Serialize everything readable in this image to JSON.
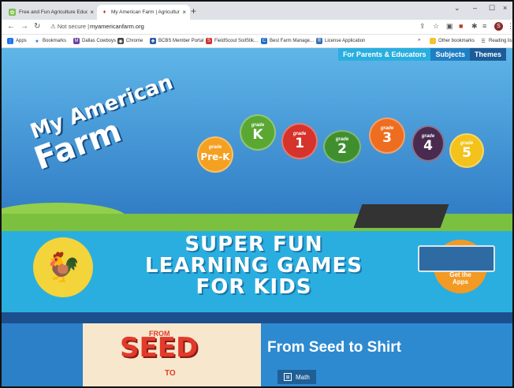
{
  "browser": {
    "tabs": [
      {
        "title": "Free and Fun Agriculture Educat",
        "close": "×",
        "favicon": "leaf-icon"
      },
      {
        "title": "My American Farm | Agricultural",
        "close": "×",
        "favicon": "farm-icon"
      }
    ],
    "new_tab": "+",
    "window": {
      "minimize": "–",
      "maximize": "☐",
      "close": "×",
      "dropdown": "⌄"
    },
    "security": "Not secure",
    "url": "myamericanfarm.org",
    "profile_initial": "S",
    "bookmarks": [
      {
        "label": "Apps",
        "icon": "apps-grid-icon",
        "color": "#1a73e8"
      },
      {
        "label": "Bookmarks",
        "icon": "star-icon",
        "color": "#1a73e8"
      },
      {
        "label": "Dallas Cowboys",
        "icon": "cowboys-icon",
        "color": "#6a3fa0"
      },
      {
        "label": "Chrome",
        "icon": "chrome-icon",
        "color": "#444444"
      },
      {
        "label": "BCBS Member Portal",
        "icon": "bcbs-icon",
        "color": "#2c5aa0"
      },
      {
        "label": "FieldScout SoilStik...",
        "icon": "fieldscout-icon",
        "color": "#d0302f"
      },
      {
        "label": "Best Farm Manage...",
        "icon": "bfm-icon",
        "color": "#1f6fc2"
      },
      {
        "label": "License Application",
        "icon": "license-icon",
        "color": "#3b6fb5"
      }
    ],
    "bookmarks_overflow": "»",
    "other_bookmarks": "Other bookmarks",
    "reading_list": "Reading list"
  },
  "site": {
    "nav": [
      "For Parents & Educators",
      "Subjects",
      "Themes"
    ],
    "logo": {
      "line1": "My",
      "line1b": "American",
      "line2": "Farm"
    },
    "grades": [
      {
        "grade": "grade",
        "label": "Pre-K",
        "color": "#f4a021"
      },
      {
        "grade": "grade",
        "label": "K",
        "color": "#5aa832"
      },
      {
        "grade": "grade",
        "label": "1",
        "color": "#d6332a"
      },
      {
        "grade": "grade",
        "label": "2",
        "color": "#3f8f2e"
      },
      {
        "grade": "grade",
        "label": "3",
        "color": "#ee6d1f"
      },
      {
        "grade": "grade",
        "label": "4",
        "color": "#4a2a4f"
      },
      {
        "grade": "grade",
        "label": "5",
        "color": "#f3c21b"
      }
    ],
    "banner": {
      "line1": "SUPER FUN",
      "line2": "LEARNING GAMES",
      "line3": "FOR KIDS"
    },
    "apps_button": {
      "line1": "Get the",
      "line2": "Apps"
    },
    "feature": {
      "title": "From Seed to Shirt",
      "art_top": "FROM",
      "art_main": "SEED",
      "art_mid": "TO",
      "subject": "Math"
    }
  }
}
